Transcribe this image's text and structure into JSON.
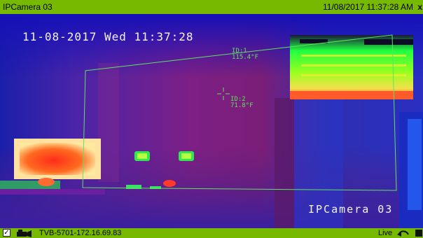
{
  "window": {
    "title": "IPCamera 03",
    "datetime": "11/08/2017 11:37:28 AM",
    "close_symbol": "x"
  },
  "video": {
    "osd_datetime": "11-08-2017 Wed 11:37:28",
    "osd_camera_name": "IPCamera 03",
    "measurements": [
      {
        "id": "ID:1",
        "temperature": "115.4°F"
      },
      {
        "id": "ID:2",
        "temperature": "71.8°F"
      }
    ]
  },
  "statusbar": {
    "checkbox_mark": "✓",
    "device": "TVB-5701-172.16.69.83",
    "mode": "Live"
  },
  "colors": {
    "bar_green": "#77b800",
    "overlay_green": "#5fe35f"
  },
  "icons": [
    "camera-icon",
    "undo-icon",
    "more-icon",
    "close-icon",
    "crosshair-icon"
  ]
}
